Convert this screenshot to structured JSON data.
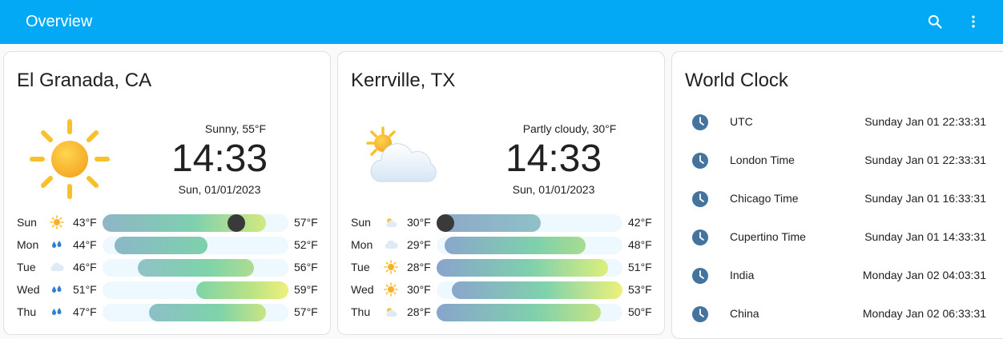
{
  "header": {
    "title": "Overview",
    "search_icon": "search-icon",
    "menu_icon": "more-vertical-icon",
    "color": "#03a9f4"
  },
  "cards": [
    {
      "title": "El Granada, CA",
      "icon": "sunny-icon",
      "condition": "Sunny, 55°F",
      "time": "14:33",
      "date": "Sun, 01/01/2023",
      "forecast": [
        {
          "day": "Sun",
          "icon": "sunny-icon",
          "low": "43°F",
          "high": "57°F",
          "dot": true
        },
        {
          "day": "Mon",
          "icon": "rain-icon",
          "low": "44°F",
          "high": "52°F"
        },
        {
          "day": "Tue",
          "icon": "cloudy-icon",
          "low": "46°F",
          "high": "56°F"
        },
        {
          "day": "Wed",
          "icon": "rain-icon",
          "low": "51°F",
          "high": "59°F"
        },
        {
          "day": "Thu",
          "icon": "rain-icon",
          "low": "47°F",
          "high": "57°F"
        }
      ]
    },
    {
      "title": "Kerrville, TX",
      "icon": "partly-cloudy-icon",
      "condition": "Partly cloudy, 30°F",
      "time": "14:33",
      "date": "Sun, 01/01/2023",
      "forecast": [
        {
          "day": "Sun",
          "icon": "partly-cloudy-icon",
          "low": "30°F",
          "high": "42°F",
          "dot": true
        },
        {
          "day": "Mon",
          "icon": "cloudy-icon",
          "low": "29°F",
          "high": "48°F"
        },
        {
          "day": "Tue",
          "icon": "sunny-icon",
          "low": "28°F",
          "high": "51°F"
        },
        {
          "day": "Wed",
          "icon": "sunny-icon",
          "low": "30°F",
          "high": "53°F"
        },
        {
          "day": "Thu",
          "icon": "partly-cloudy-icon",
          "low": "28°F",
          "high": "50°F"
        }
      ]
    }
  ],
  "world_clock": {
    "title": "World Clock",
    "icon": "clock-icon",
    "icon_color": "#44739e",
    "clocks": [
      {
        "name": "UTC",
        "time": "Sunday Jan 01 22:33:31"
      },
      {
        "name": "London Time",
        "time": "Sunday Jan 01 22:33:31"
      },
      {
        "name": "Chicago Time",
        "time": "Sunday Jan 01 16:33:31"
      },
      {
        "name": "Cupertino Time",
        "time": "Sunday Jan 01 14:33:31"
      },
      {
        "name": "India",
        "time": "Monday Jan 02 04:03:31"
      },
      {
        "name": "China",
        "time": "Monday Jan 02 06:33:31"
      }
    ]
  }
}
